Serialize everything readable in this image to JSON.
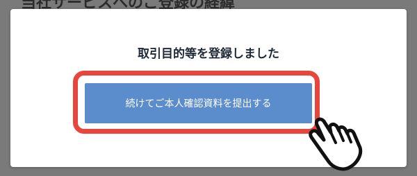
{
  "background": {
    "heading": "当社サービスへのご登録の経緯"
  },
  "modal": {
    "title": "取引目的等を登録しました",
    "primary_button_label": "続けてご本人確認資料を提出する"
  },
  "annotations": {
    "highlight_color": "#e8453c",
    "cursor_icon": "hand-pointer-icon"
  },
  "colors": {
    "button_bg": "#5b8ccb",
    "overlay": "#7a7a7a",
    "modal_bg": "#ffffff"
  }
}
